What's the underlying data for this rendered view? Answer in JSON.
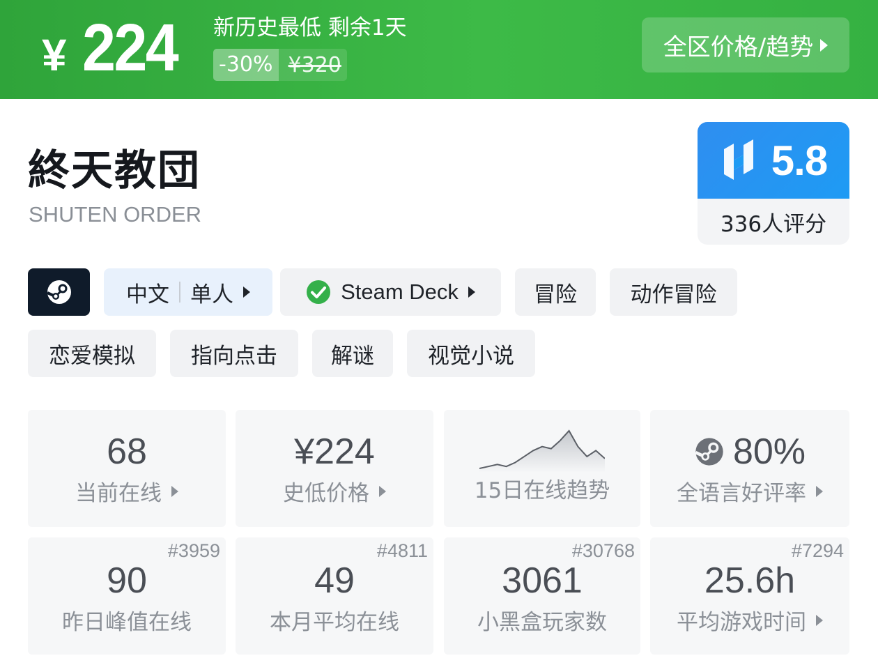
{
  "price": {
    "symbol": "¥",
    "current": "224",
    "note": "新历史最低 剩余1天",
    "discount": "-30%",
    "original": "¥320",
    "region_button": "全区价格/趋势"
  },
  "game": {
    "title": "終天教団",
    "subtitle": "SHUTEN ORDER"
  },
  "rating": {
    "score": "5.8",
    "count_label": "336人评分"
  },
  "tags": {
    "language": "中文",
    "mode": "单人",
    "deck": "Steam Deck",
    "genres": [
      "冒险",
      "动作冒险",
      "恋爱模拟",
      "指向点击",
      "解谜",
      "视觉小说"
    ]
  },
  "stats": {
    "online_now": {
      "value": "68",
      "label": "当前在线"
    },
    "lowest_price": {
      "value": "¥224",
      "label": "史低价格"
    },
    "trend": {
      "label": "15日在线趋势",
      "points": [
        3,
        4,
        5,
        4,
        6,
        9,
        12,
        14,
        13,
        17,
        22,
        14,
        9,
        12,
        8
      ]
    },
    "positive": {
      "value": "80%",
      "label": "全语言好评率"
    },
    "peak_yesterday": {
      "value": "90",
      "label": "昨日峰值在线",
      "rank": "#3959"
    },
    "month_avg": {
      "value": "49",
      "label": "本月平均在线",
      "rank": "#4811"
    },
    "players": {
      "value": "3061",
      "label": "小黑盒玩家数",
      "rank": "#30768"
    },
    "playtime": {
      "value": "25.6h",
      "label": "平均游戏时间",
      "rank": "#7294"
    }
  },
  "colors": {
    "banner_green": "#3dba47",
    "rating_blue": "#1e9bf4",
    "deck_check": "#34b04a",
    "steam_dark": "#0f1b2a"
  }
}
